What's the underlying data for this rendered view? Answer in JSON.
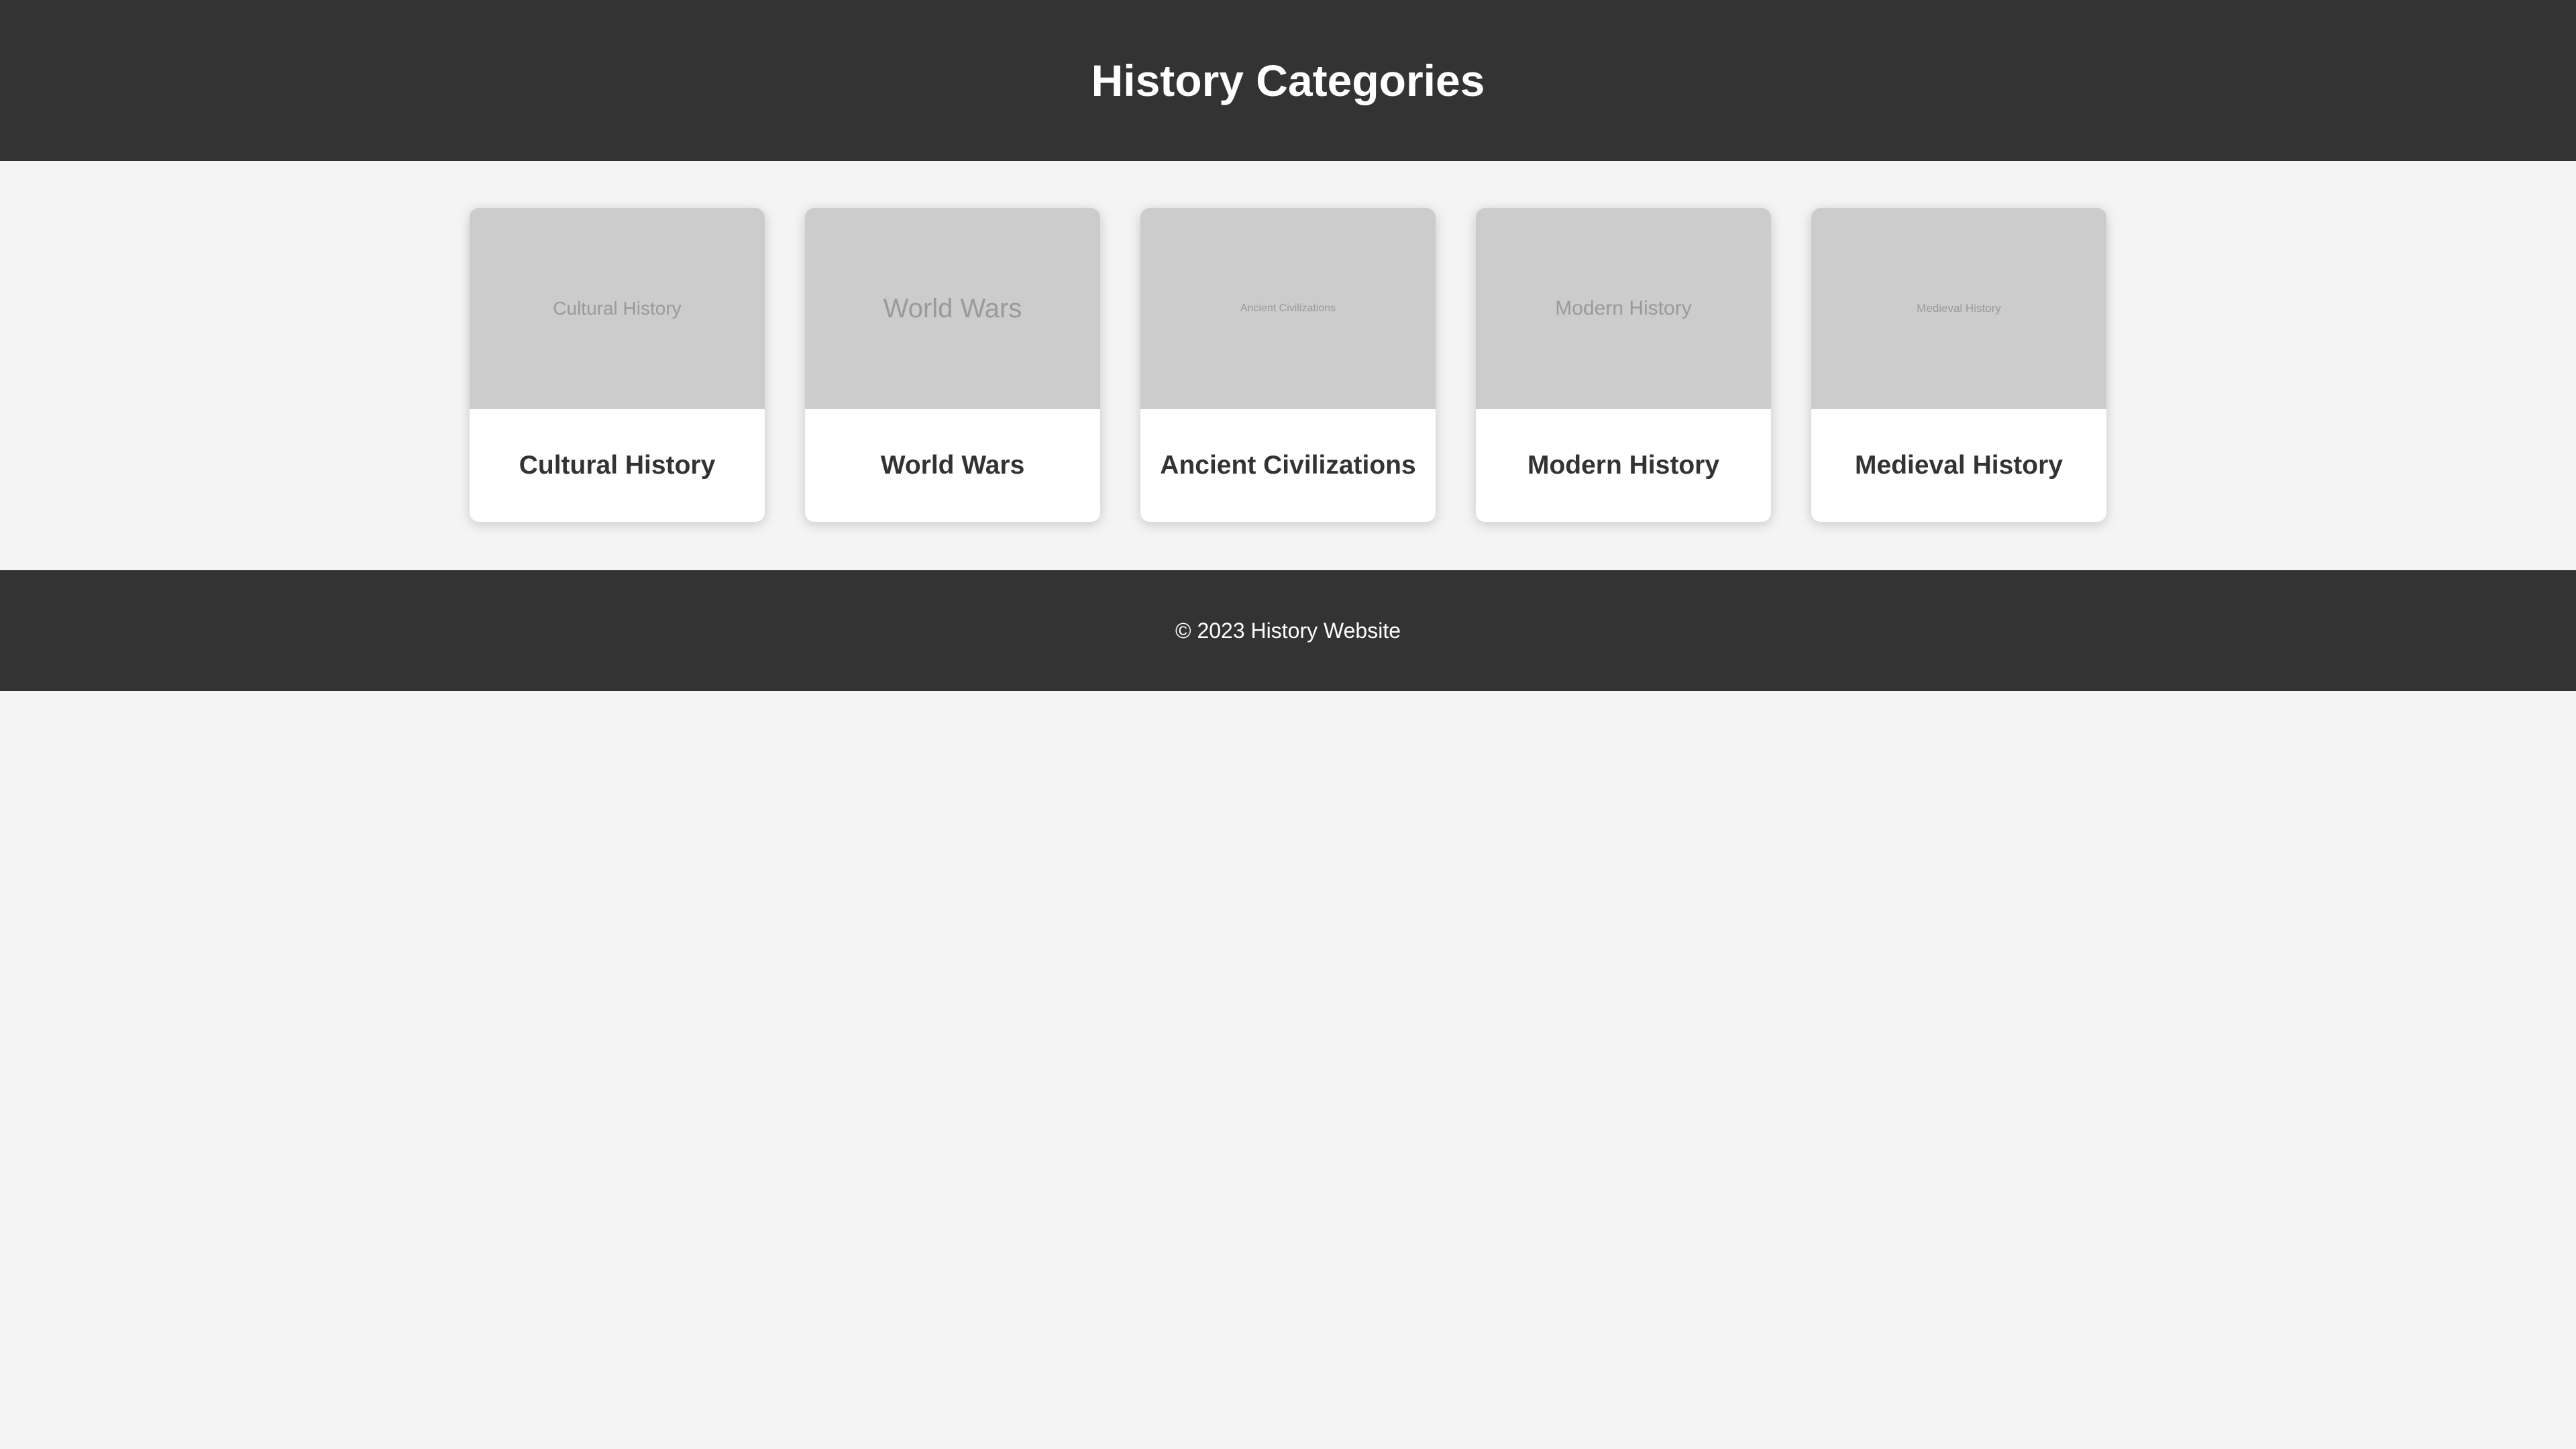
{
  "header": {
    "title": "History Categories"
  },
  "categories": [
    {
      "image_text": "Cultural History",
      "title": "Cultural History"
    },
    {
      "image_text": "World Wars",
      "title": "World Wars"
    },
    {
      "image_text": "Ancient Civilizations",
      "title": "Ancient Civilizations"
    },
    {
      "image_text": "Modern History",
      "title": "Modern History"
    },
    {
      "image_text": "Medieval History",
      "title": "Medieval History"
    }
  ],
  "footer": {
    "text": "© 2023 History Website"
  },
  "colors": {
    "header_bg": "#333333",
    "page_bg": "#f4f4f4",
    "card_bg": "#ffffff",
    "image_placeholder_bg": "#cccccc",
    "placeholder_text": "#9a9a9a",
    "title_text": "#333333"
  }
}
